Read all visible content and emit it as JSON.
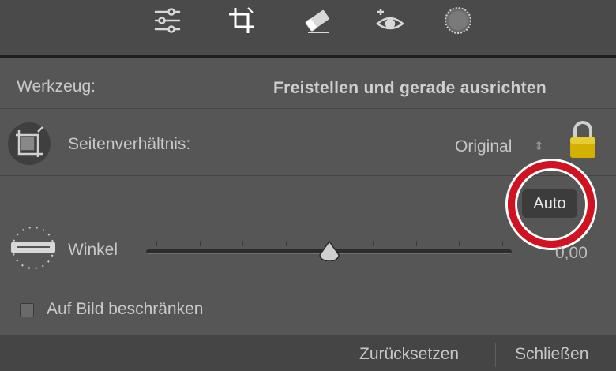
{
  "toolbar": {
    "tools": [
      {
        "icon": "sliders-icon"
      },
      {
        "icon": "crop-icon"
      },
      {
        "icon": "eraser-icon"
      },
      {
        "icon": "red-eye-icon"
      },
      {
        "icon": "radial-mask-icon"
      }
    ]
  },
  "tool": {
    "label": "Werkzeug:",
    "value": "Freistellen und gerade ausrichten"
  },
  "aspect": {
    "label": "Seitenverhältnis:",
    "value": "Original",
    "stepper": "⇕"
  },
  "angle": {
    "auto_label": "Auto",
    "label": "Winkel",
    "value": "0,00",
    "slider_position": 0.5
  },
  "constrain": {
    "label": "Auf Bild beschränken",
    "checked": false
  },
  "footer": {
    "reset_label": "Zurücksetzen",
    "close_label": "Schließen"
  },
  "colors": {
    "highlight_ring": "#d21220",
    "lock": "#d4b000"
  }
}
